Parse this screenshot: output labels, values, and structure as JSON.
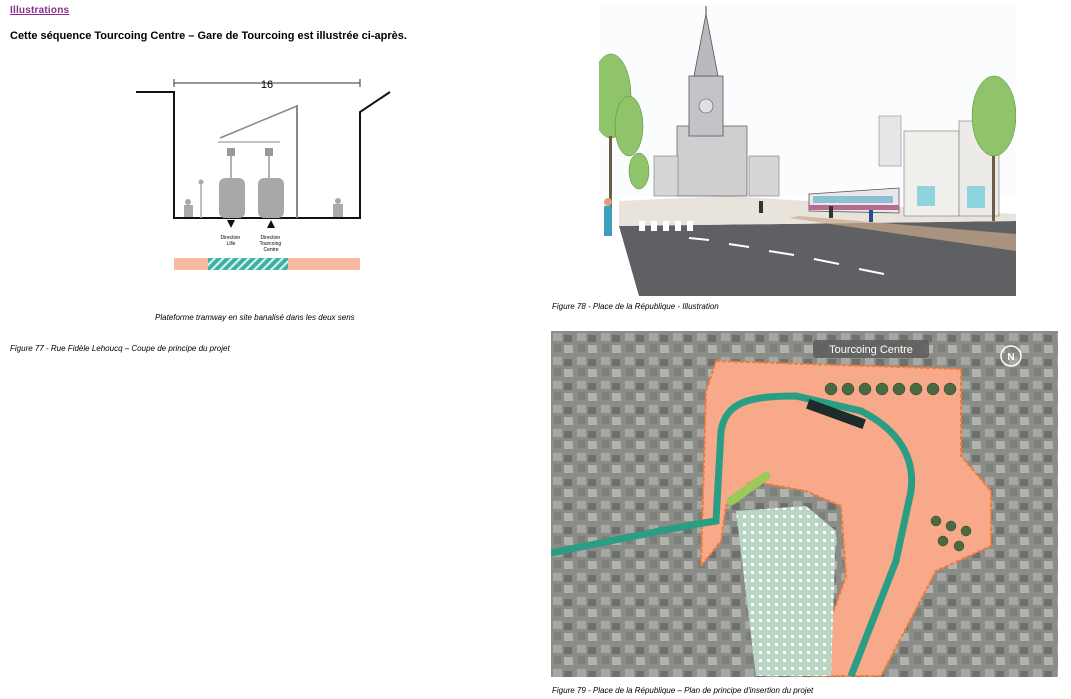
{
  "heading": "Illustrations",
  "intro": "Cette séquence Tourcoing Centre – Gare de Tourcoing est illustrée ci-après.",
  "section": {
    "width_label": "16",
    "dir_left": [
      "Direction",
      "Lille"
    ],
    "dir_right": [
      "Direction",
      "Tourcoing",
      "Centre"
    ],
    "platform_caption": "Plateforme tramway en site banalisé dans les deux sens",
    "colors": {
      "sidewalk": "#f7b9a0",
      "tram": "#3ab09e"
    }
  },
  "captions": {
    "fig77": "Figure 77 - Rue Fidèle Lehoucq – Coupe de principe du projet",
    "fig78": "Figure 78 - Place de la République - Illustration",
    "fig79": "Figure 79 - Place de la République – Plan de principe d'insertion du projet"
  },
  "plan": {
    "label": "Tourcoing Centre",
    "compass": "N",
    "colors": {
      "square": "#f7a98a",
      "tram": "#2a9d85",
      "border": "#f07a3a"
    }
  }
}
